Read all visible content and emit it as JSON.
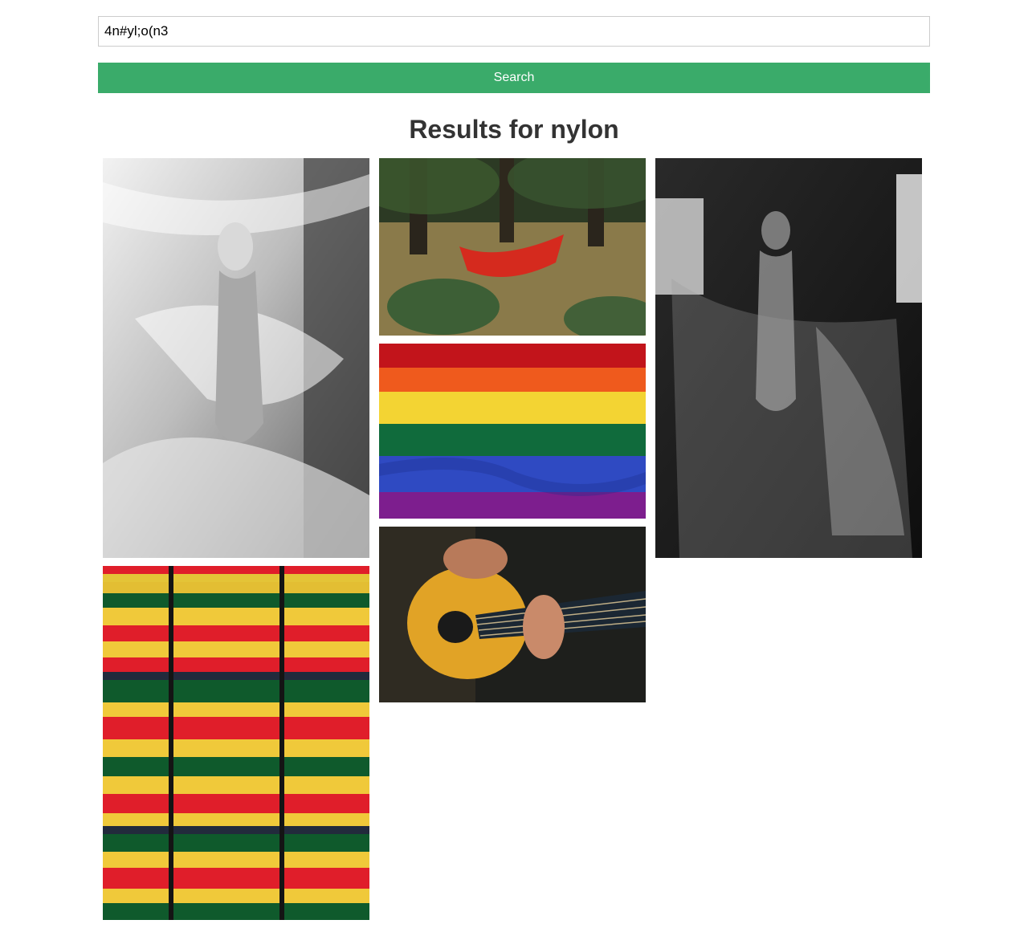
{
  "search": {
    "value": "4n#yl;o(n3",
    "button_label": "Search"
  },
  "results": {
    "heading": "Results for nylon"
  },
  "photos": [
    {
      "subject": "woman wrapped in plastic sheet, black and white"
    },
    {
      "subject": "red hammock in a forest"
    },
    {
      "subject": "woman dancing with plastic sheet, black and white"
    },
    {
      "subject": "rainbow flag"
    },
    {
      "subject": "person playing acoustic guitar"
    },
    {
      "subject": "red, yellow and green striped fabric"
    }
  ],
  "colors": {
    "accent": "#3aab6a",
    "heading": "#333333",
    "input_border": "#cccccc"
  }
}
